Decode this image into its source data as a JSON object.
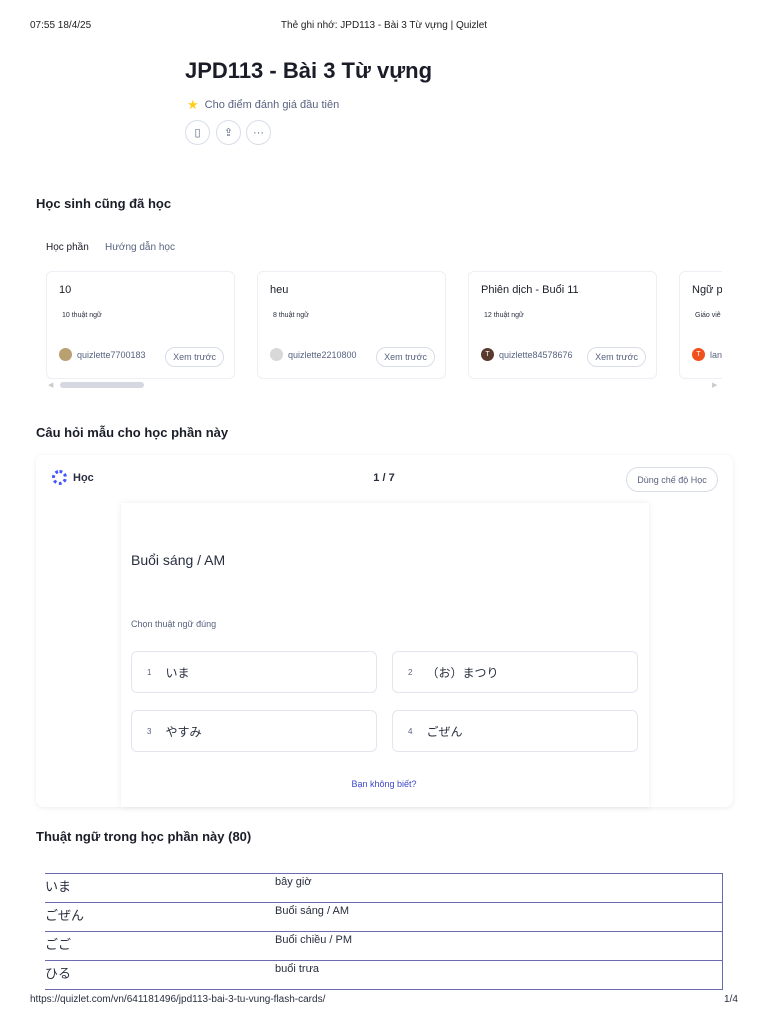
{
  "print_header": {
    "datetime": "07:55 18/4/25",
    "title": "Thẻ ghi nhớ: JPD113 - Bài 3 Từ vựng | Quizlet"
  },
  "set": {
    "title": "JPD113 - Bài 3 Từ vựng",
    "rating": "Cho điểm đánh giá đầu tiên"
  },
  "also_studied": {
    "heading": "Học sinh cũng đã học",
    "tabs": [
      "Học phần",
      "Hướng dẫn học"
    ],
    "cards": [
      {
        "title": "10",
        "count": "10 thuật ngữ",
        "user": "quizlette7700183",
        "preview": "Xem trước",
        "avatar_color": "#b8a070",
        "avatar_letter": ""
      },
      {
        "title": "heu",
        "count": "8 thuật ngữ",
        "user": "quizlette2210800",
        "preview": "Xem trước",
        "avatar_color": "#d8d8d8",
        "avatar_letter": ""
      },
      {
        "title": "Phiên dịch - Buổi 11",
        "count": "12 thuật ngữ",
        "user": "quizlette84578676",
        "preview": "Xem trước",
        "avatar_color": "#5a3a2e",
        "avatar_letter": "T"
      },
      {
        "title": "Ngữ pl",
        "count": "Giáo viê",
        "user": "lan",
        "preview": "",
        "avatar_color": "#f0501e",
        "avatar_letter": "T"
      }
    ]
  },
  "sample": {
    "heading": "Câu hỏi mẫu cho học phần này",
    "mode": "Học",
    "progress": "1 / 7",
    "use_mode": "Dùng chế độ Học",
    "question": "Buổi sáng / AM",
    "prompt": "Chọn thuật ngữ đúng",
    "options": [
      {
        "k": "1",
        "v": "いま"
      },
      {
        "k": "2",
        "v": "（お）まつり"
      },
      {
        "k": "3",
        "v": "やすみ"
      },
      {
        "k": "4",
        "v": "ごぜん"
      }
    ],
    "dont_know": "Bạn không biết?"
  },
  "terms": {
    "heading": "Thuật ngữ trong học phần này (80)",
    "rows": [
      {
        "t": "いま",
        "d": "bây giờ"
      },
      {
        "t": "ごぜん",
        "d": "Buổi sáng / AM"
      },
      {
        "t": "ごご",
        "d": "Buổi chiều / PM"
      },
      {
        "t": "ひる",
        "d": "buổi trưa"
      }
    ]
  },
  "print_footer": {
    "url": "https://quizlet.com/vn/641181496/jpd113-bai-3-tu-vung-flash-cards/",
    "page": "1/4"
  }
}
